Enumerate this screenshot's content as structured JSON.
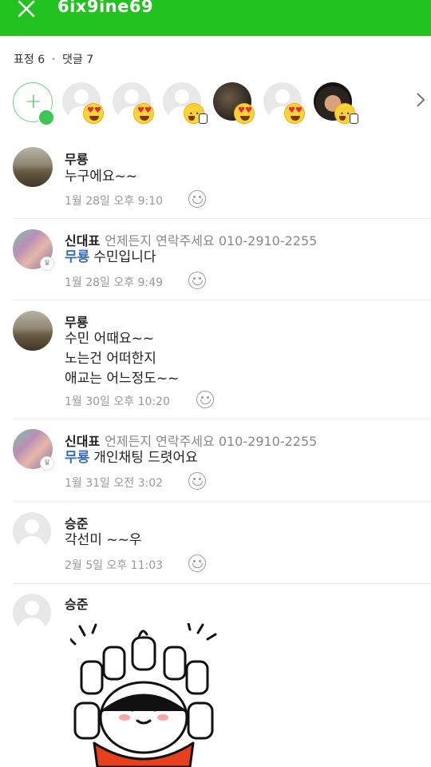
{
  "header": {
    "title": "6ix9ine69"
  },
  "counts": {
    "reactions": "표정 6",
    "separator": "•",
    "comments": "댓글 7"
  },
  "reactors": [
    {
      "avatar": "default-avatar",
      "emoji": "heart-eyes-emoji"
    },
    {
      "avatar": "default-avatar",
      "emoji": "heart-eyes-emoji"
    },
    {
      "avatar": "default-avatar",
      "emoji": "thumbs-up-emoji"
    },
    {
      "avatar": "photo-avatar",
      "emoji": "heart-eyes-emoji"
    },
    {
      "avatar": "default-avatar",
      "emoji": "heart-eyes-emoji"
    },
    {
      "avatar": "photo-avatar",
      "emoji": "thumbs-up-emoji"
    }
  ],
  "comments": [
    {
      "name": "무룡",
      "status": "",
      "mention": "",
      "lines": [
        "누구에요~~"
      ],
      "time": "1월 28일 오후 9:10"
    },
    {
      "name": "신대표",
      "status": "언제든지 연락주세요 010-2910-2255",
      "mention": "무룡",
      "lines": [
        "수민입니다"
      ],
      "time": "1월 28일 오후 9:49"
    },
    {
      "name": "무룡",
      "status": "",
      "mention": "",
      "lines": [
        "수민 어때요~~",
        "노는건 어떠한지",
        "애교는 어느정도~~"
      ],
      "time": "1월 30일 오후 10:20"
    },
    {
      "name": "신대표",
      "status": "언제든지 연락주세요 010-2910-2255",
      "mention": "무룡",
      "lines": [
        "개인채팅 드렷어요"
      ],
      "time": "1월 31일 오전 3:02"
    },
    {
      "name": "승준",
      "status": "",
      "mention": "",
      "lines": [
        "각선미 ~~우"
      ],
      "time": "2월 5일 오후 11:03"
    },
    {
      "name": "승준",
      "status": "",
      "mention": "",
      "lines": [],
      "time": "",
      "sticker": "thumbs-up-sticker"
    }
  ],
  "colors": {
    "brand": "#22c321",
    "mention": "#3a6fbf",
    "meta": "#999999"
  }
}
